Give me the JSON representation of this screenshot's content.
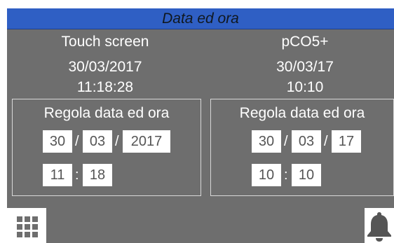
{
  "header": {
    "title": "Data ed ora"
  },
  "touch_screen": {
    "label": "Touch screen",
    "date": "30/03/2017",
    "time": "11:18:28",
    "panel_title": "Regola data ed ora",
    "day": "30",
    "month": "03",
    "year": "2017",
    "hour": "11",
    "minute": "18"
  },
  "pco": {
    "label": "pCO5+",
    "date": "30/03/17",
    "time": "10:10",
    "panel_title": "Regola data ed ora",
    "day": "30",
    "month": "03",
    "year": "17",
    "hour": "10",
    "minute": "10"
  },
  "separators": {
    "date": "/",
    "time": ":"
  },
  "footer": {
    "menu_icon": "grid-menu-icon",
    "alarm_icon": "bell-icon"
  },
  "colors": {
    "title_bar": "#2f5fc4",
    "background": "#6e6e6e"
  }
}
